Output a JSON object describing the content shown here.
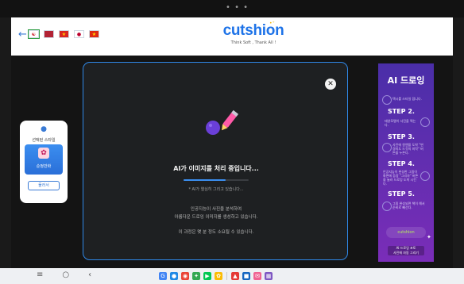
{
  "topbar": {
    "dots": "• • •"
  },
  "header": {
    "back_icon": "arrow-left",
    "flags": [
      {
        "name": "korea",
        "active": true,
        "bg": "#ffffff",
        "glyph": "☯",
        "glyph_color": "#cd2e3a"
      },
      {
        "name": "usa",
        "active": false,
        "bg": "#b22234",
        "glyph": "",
        "glyph_color": "#ffffff"
      },
      {
        "name": "vietnam",
        "active": false,
        "bg": "#da251d",
        "glyph": "★",
        "glyph_color": "#ffcd00"
      },
      {
        "name": "japan",
        "active": false,
        "bg": "#ffffff",
        "glyph": "●",
        "glyph_color": "#bc002d"
      },
      {
        "name": "china",
        "active": false,
        "bg": "#de2910",
        "glyph": "★",
        "glyph_color": "#ffde00"
      }
    ],
    "logo_text": "cutshion",
    "logo_tagline": "Think Soft , Thank All !"
  },
  "left_panel": {
    "title": "선택된 스타일",
    "style_name": "순정만화",
    "change_button": "물러서",
    "icon": "palette-icon"
  },
  "modal": {
    "title": "AI가 이미지를 처리 중입니다...",
    "progress": 0.65,
    "status": "* AI가 열심히 그리고 있습니다...",
    "description_line1": "인공지능이 사진을 분석하여",
    "description_line2": "아름다운 드로잉 이미지를 생성하고 있습니다.",
    "note": "이 과정은 몇 분 정도 소요될 수 있습니다.",
    "close_icon": "close-icon"
  },
  "banner": {
    "title": "AI 드로잉",
    "intro": "택시를 스타일 잡니다.",
    "steps": [
      {
        "label": "STEP 2.",
        "text": "태양모델이 사진을 찍는다."
      },
      {
        "label": "STEP 3.",
        "text": "사진에 원엔을 도착 \"변경의도 드것의 미작\" 버튼을 누른다."
      },
      {
        "label": "STEP 4.",
        "text": "안공지능이 완성한 그림이 화면에 등장 \"그리자\" 버튼을 눌러 드로잉 도착 시킨다."
      },
      {
        "label": "STEP 5.",
        "text": "그림 완성되면 책이 해서 준비로 빼건다."
      }
    ],
    "brand": "cutshion",
    "cta_line1": "AI 드로잉 포토",
    "cta_line2": "사진에 자동 그리기"
  },
  "navbar": {
    "keys": [
      "≡",
      "○",
      "‹"
    ],
    "apps": [
      {
        "name": "google",
        "color": "#4285f4",
        "glyph": "G"
      },
      {
        "name": "chat",
        "color": "#1e88e5",
        "glyph": "●"
      },
      {
        "name": "chrome",
        "color": "#ea4335",
        "glyph": "◉"
      },
      {
        "name": "assistant",
        "color": "#34a853",
        "glyph": "✦"
      },
      {
        "name": "play-store",
        "color": "#00c853",
        "glyph": "▶"
      },
      {
        "name": "photos",
        "color": "#fbbc04",
        "glyph": "✿"
      },
      {
        "name": "separator",
        "color": "",
        "glyph": ""
      },
      {
        "name": "app-1",
        "color": "#e53935",
        "glyph": "▲"
      },
      {
        "name": "app-2",
        "color": "#1565c0",
        "glyph": "■"
      },
      {
        "name": "app-3",
        "color": "#f06292",
        "glyph": "✉"
      },
      {
        "name": "app-4",
        "color": "#7e57c2",
        "glyph": "▦"
      }
    ]
  },
  "colors": {
    "accent": "#2f88e8",
    "brand": "#1e73e8",
    "banner_top": "#4a2ea8",
    "banner_bottom": "#7a2db8"
  }
}
